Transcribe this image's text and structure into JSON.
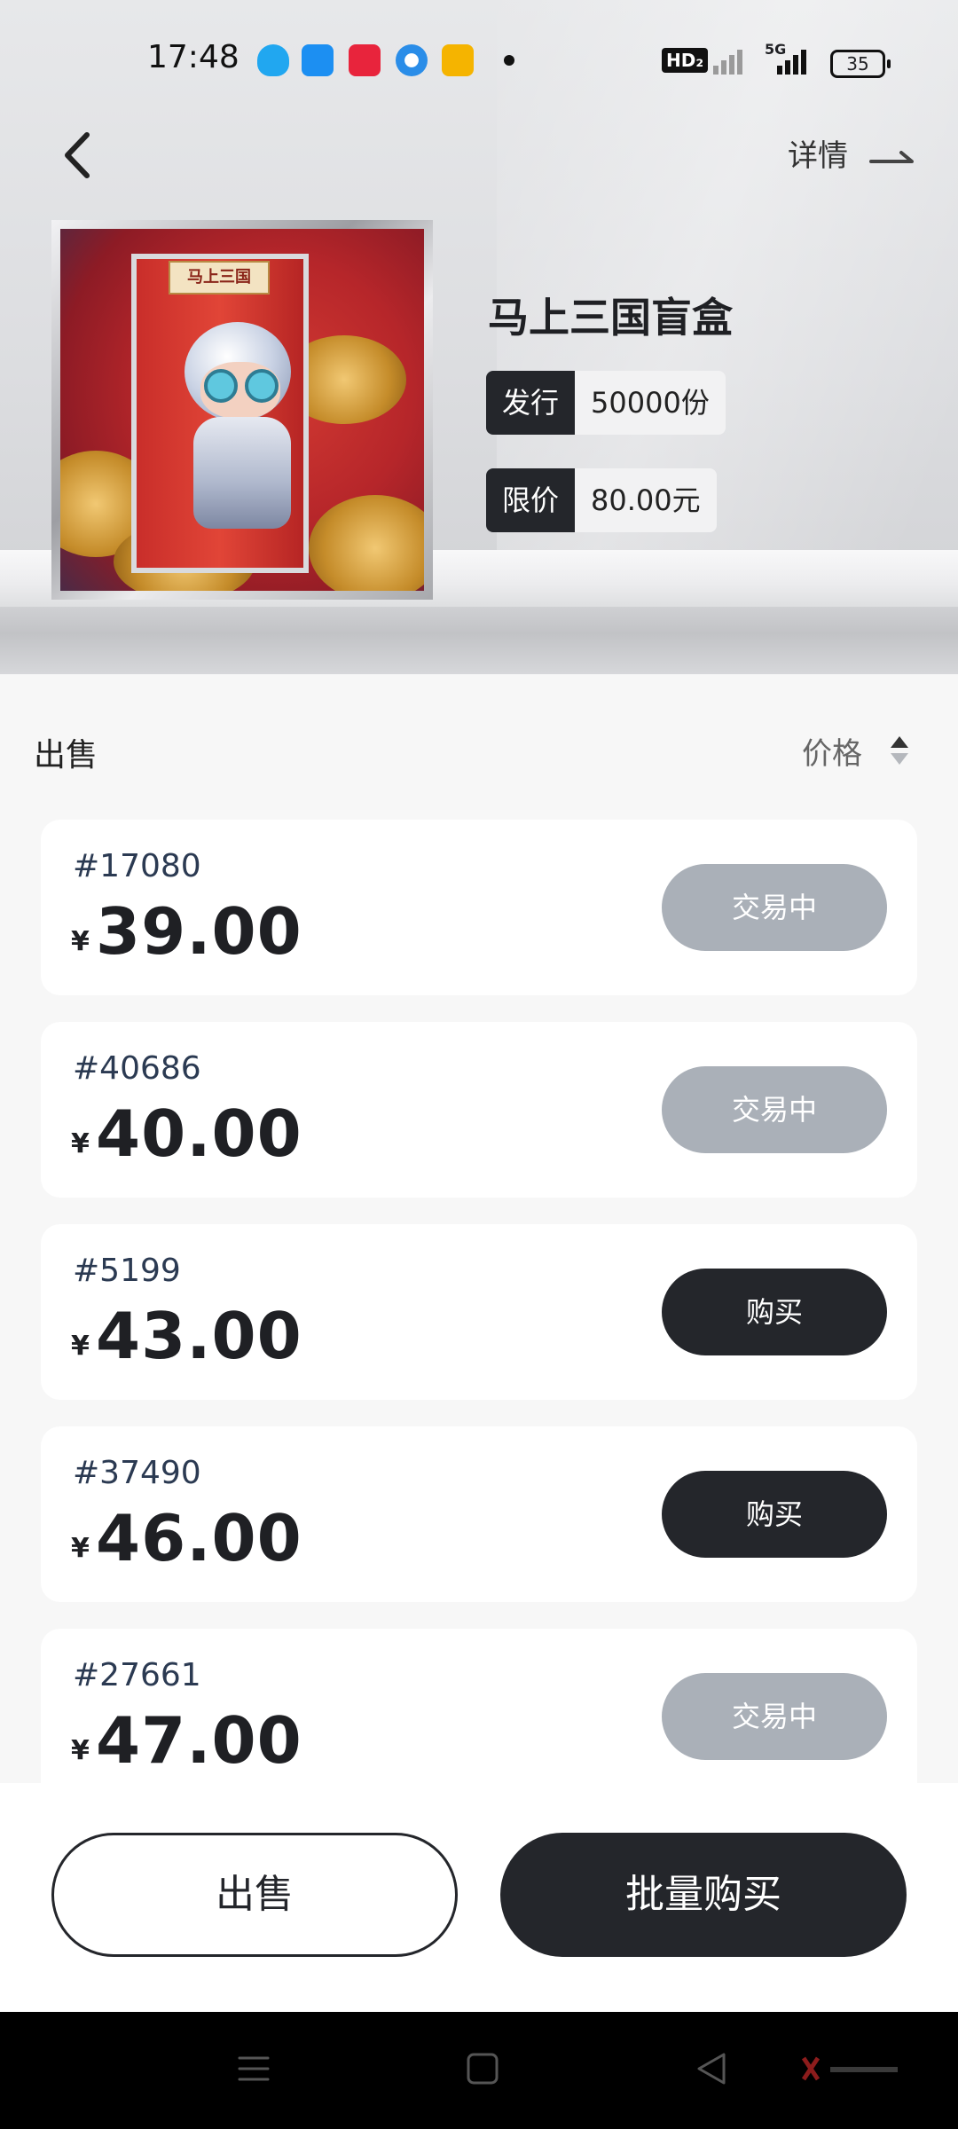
{
  "status_bar": {
    "time": "17:48",
    "network": "HD₂",
    "network_gen": "5G",
    "battery": "35"
  },
  "header": {
    "detail_label": "详情"
  },
  "product": {
    "box_label": "马上三国",
    "title": "马上三国盲盒",
    "issue_key": "发行",
    "issue_value": "50000份",
    "limit_key": "限价",
    "limit_value": "80.00元"
  },
  "list": {
    "section_title": "出售",
    "sort_label": "价格",
    "currency": "¥",
    "items": [
      {
        "serial": "#17080",
        "price": "39.00",
        "action": "交易中",
        "state": "trading"
      },
      {
        "serial": "#40686",
        "price": "40.00",
        "action": "交易中",
        "state": "trading"
      },
      {
        "serial": "#5199",
        "price": "43.00",
        "action": "购买",
        "state": "buy"
      },
      {
        "serial": "#37490",
        "price": "46.00",
        "action": "购买",
        "state": "buy"
      },
      {
        "serial": "#27661",
        "price": "47.00",
        "action": "交易中",
        "state": "trading"
      }
    ]
  },
  "footer": {
    "sell_label": "出售",
    "batch_buy_label": "批量购买"
  },
  "colors": {
    "dark": "#24262b",
    "trading_button": "#aab0b8",
    "background": "#f7f7f7"
  }
}
